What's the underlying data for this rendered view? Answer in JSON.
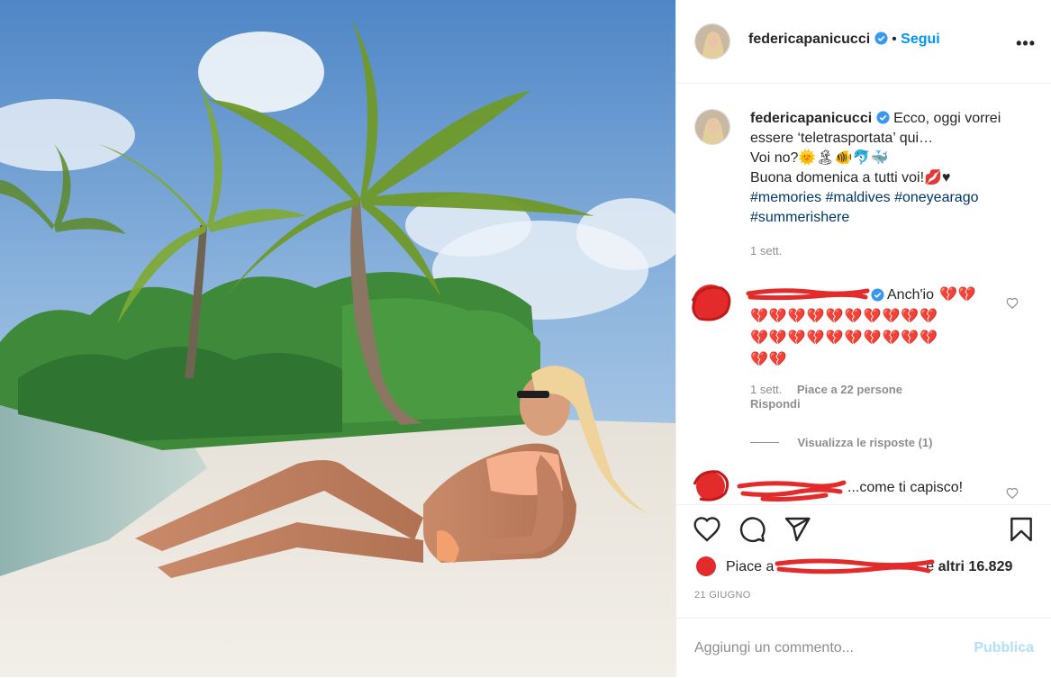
{
  "post": {
    "username": "federicapanicucci",
    "follow_label": "Segui",
    "dot": "•",
    "more_label": "•••"
  },
  "caption": {
    "username": "federicapanicucci",
    "line1": "Ecco, oggi vorrei essere ‘teletrasportata’ qui…",
    "line2": "Voi no?🌞🏝🐠🐬🐳",
    "line3": "Buona domenica a tutti voi!💋♥",
    "hashtags": [
      "#memories",
      "#maldives",
      "#oneyearago",
      "#summerishere"
    ],
    "time": "1 sett."
  },
  "comments": [
    {
      "text": "Anch'io",
      "hearts_rows": [
        "💔💔",
        "💔💔💔💔💔💔💔💔💔💔",
        "💔💔💔💔💔💔💔💔💔💔",
        "💔💔"
      ],
      "time": "1 sett.",
      "likes": "Piace a 22 persone",
      "reply": "Rispondi",
      "view_replies": "Visualizza le risposte (1)"
    },
    {
      "text": "...come ti capisco!"
    }
  ],
  "likes": {
    "prefix": "Piace a",
    "suffix": "e",
    "others": "altri 16.829"
  },
  "date": "21 GIUGNO",
  "add_comment": {
    "placeholder": "Aggiungi un commento...",
    "publish": "Pubblica"
  },
  "icons": [
    "heart-icon",
    "comment-icon",
    "share-icon",
    "bookmark-icon",
    "verified-icon",
    "more-icon"
  ],
  "colors": {
    "accent": "#0095f6",
    "hashtag": "#00376b",
    "redact": "#e32b2b",
    "publish_disabled": "#b2dffc"
  }
}
